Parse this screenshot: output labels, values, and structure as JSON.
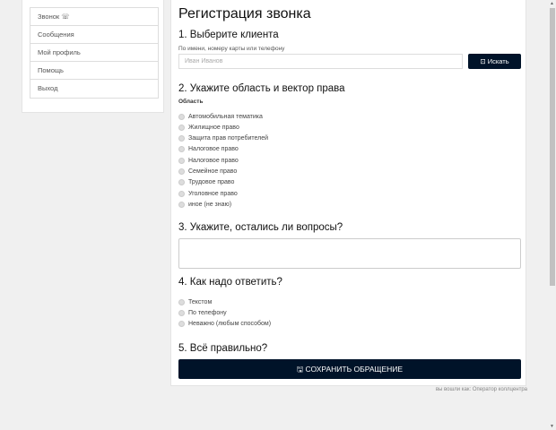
{
  "sidebar": {
    "items": [
      {
        "label": "Звонок ☏"
      },
      {
        "label": "Сообщения"
      },
      {
        "label": "Мой профиль"
      },
      {
        "label": "Помощь"
      },
      {
        "label": "Выход"
      }
    ]
  },
  "main": {
    "title": "Регистрация звонка",
    "s1": {
      "heading": "1. Выберите клиента",
      "hint": "По имени, номеру карты или телефону",
      "placeholder": "Иван Иванов",
      "search": "Искать"
    },
    "s2": {
      "heading": "2. Укажите область и вектор права",
      "label": "Область",
      "options": [
        "Автомобильная тематика",
        "Жилищное право",
        "Защита прав потребителей",
        "Налоговое право",
        "Налоговое право",
        "Семейное право",
        "Трудовое право",
        "Уголовное право",
        "иное (не знаю)"
      ]
    },
    "s3": {
      "heading": "3. Укажите, остались ли вопросы?"
    },
    "s4": {
      "heading": "4. Как надо ответить?",
      "options": [
        "Текстом",
        "По телефону",
        "Неважно (любым способом)"
      ]
    },
    "s5": {
      "heading": "5. Всё правильно?",
      "save": "СОХРАНИТЬ ОБРАЩЕНИЕ"
    }
  },
  "footer": "вы вошли как: Оператор коллцентра"
}
